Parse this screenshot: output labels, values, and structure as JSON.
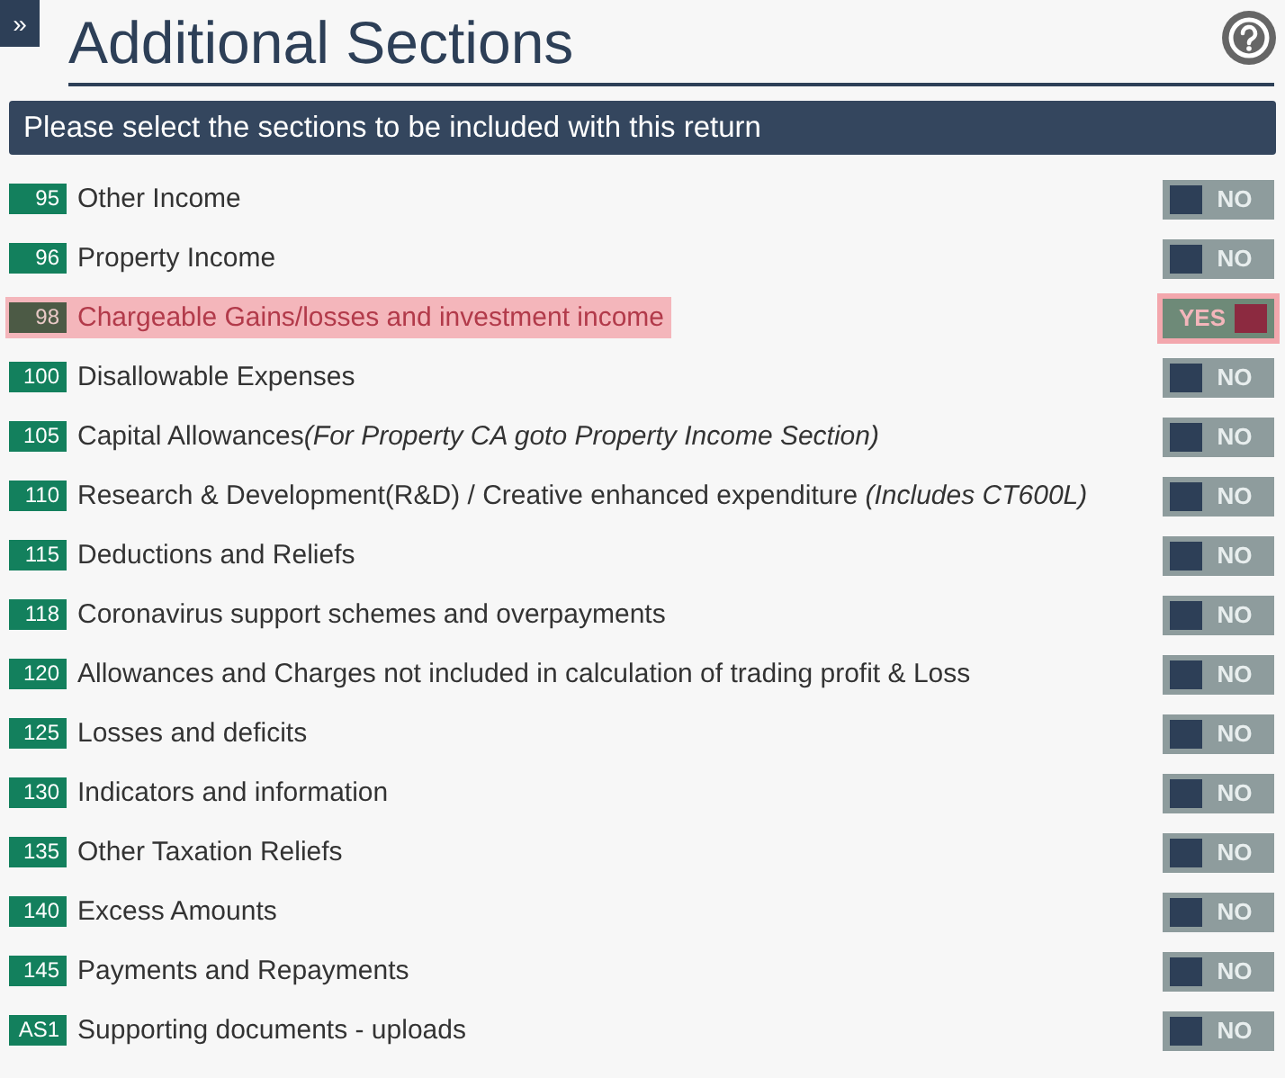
{
  "expand_button": "»",
  "title": "Additional Sections",
  "banner": "Please select the sections to be included with this return",
  "sections": [
    {
      "code": "95",
      "label": "Other Income",
      "on": false,
      "toggle": "NO"
    },
    {
      "code": "96",
      "label": "Property Income",
      "on": false,
      "toggle": "NO"
    },
    {
      "code": "98",
      "label": "Chargeable Gains/losses and investment income",
      "on": true,
      "toggle": "YES"
    },
    {
      "code": "100",
      "label": "Disallowable Expenses",
      "on": false,
      "toggle": "NO"
    },
    {
      "code": "105",
      "label": "Capital Allowances",
      "note": "(For Property CA goto Property Income Section)",
      "on": false,
      "toggle": "NO"
    },
    {
      "code": "110",
      "label": "Research & Development(R&D) / Creative enhanced expenditure ",
      "note": "(Includes CT600L)",
      "on": false,
      "toggle": "NO"
    },
    {
      "code": "115",
      "label": "Deductions and Reliefs",
      "on": false,
      "toggle": "NO"
    },
    {
      "code": "118",
      "label": "Coronavirus support schemes and overpayments",
      "on": false,
      "toggle": "NO"
    },
    {
      "code": "120",
      "label": "Allowances and Charges not included in calculation of trading profit & Loss",
      "on": false,
      "toggle": "NO"
    },
    {
      "code": "125",
      "label": "Losses and deficits",
      "on": false,
      "toggle": "NO"
    },
    {
      "code": "130",
      "label": "Indicators and information",
      "on": false,
      "toggle": "NO"
    },
    {
      "code": "135",
      "label": "Other Taxation Reliefs",
      "on": false,
      "toggle": "NO"
    },
    {
      "code": "140",
      "label": "Excess Amounts",
      "on": false,
      "toggle": "NO"
    },
    {
      "code": "145",
      "label": "Payments and Repayments",
      "on": false,
      "toggle": "NO"
    },
    {
      "code": "AS1",
      "label": "Supporting documents - uploads",
      "on": false,
      "toggle": "NO"
    }
  ]
}
